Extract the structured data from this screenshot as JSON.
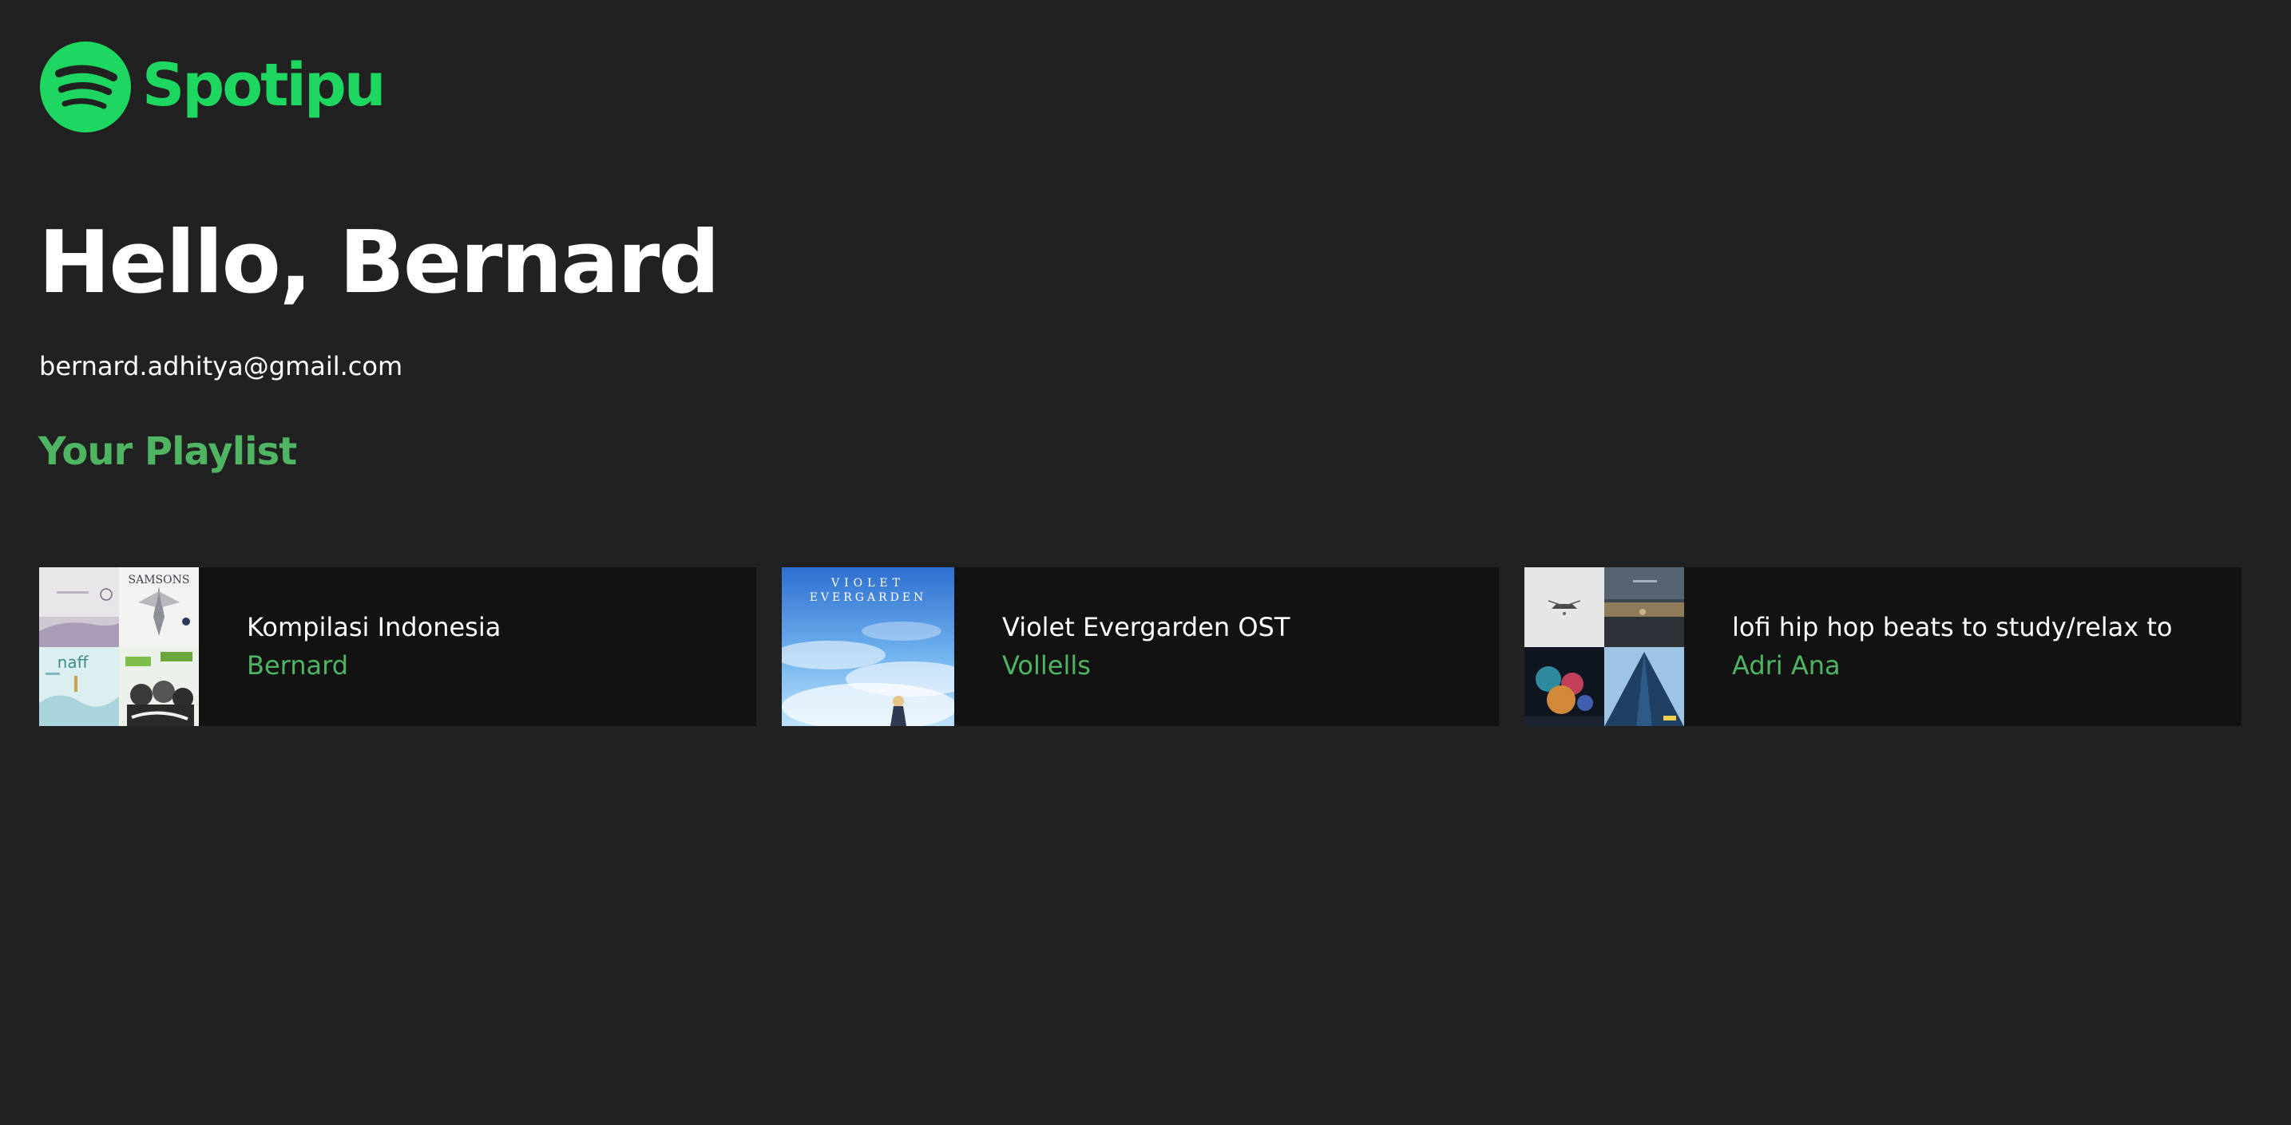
{
  "app": {
    "name": "Spotipu",
    "brand_color": "#1ed760",
    "accent_color": "#4fb563",
    "background": "#212121",
    "card_background": "#121212"
  },
  "profile": {
    "greeting": "Hello, Bernard",
    "email": "bernard.adhitya@gmail.com"
  },
  "playlists_section": {
    "title": "Your Playlist",
    "items": [
      {
        "name": "Kompilasi Indonesia",
        "owner": "Bernard",
        "cover_style": "mosaic-4",
        "cover_texts": [
          "SAMSONS",
          "naff"
        ]
      },
      {
        "name": "Violet Evergarden OST",
        "owner": "Vollells",
        "cover_style": "single",
        "cover_texts": [
          "VIOLET",
          "EVERGARDEN"
        ]
      },
      {
        "name": "lofi hip hop beats to study/relax to",
        "owner": "Adri Ana",
        "cover_style": "mosaic-4",
        "cover_texts": []
      }
    ]
  }
}
